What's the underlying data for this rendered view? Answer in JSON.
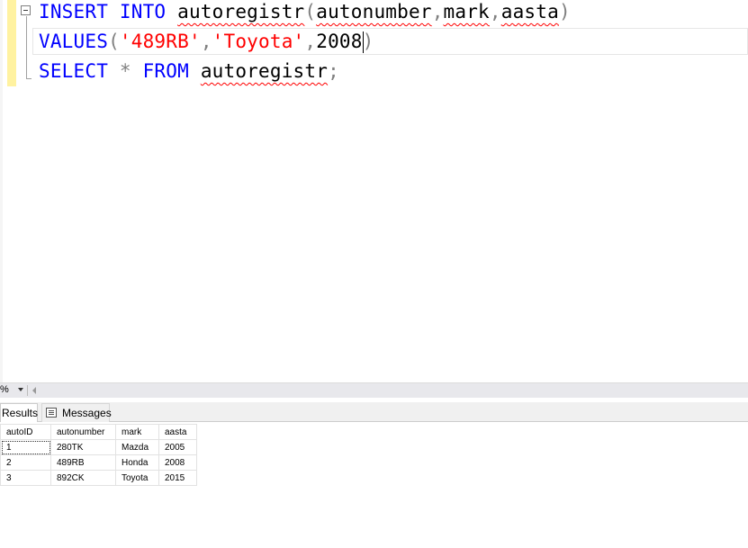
{
  "editor": {
    "line1": {
      "insert": "INSERT",
      "into": "INTO",
      "table": "autoregistr",
      "open_paren": "(",
      "col1": "autonumber",
      "comma1": ",",
      "col2": "mark",
      "comma2": ",",
      "col3": "aasta",
      "close_paren": ")"
    },
    "line2": {
      "values": "VALUES",
      "open_paren": "(",
      "val1": "'489RB'",
      "comma1": ",",
      "val2": "'Toyota'",
      "comma2": ",",
      "val3": "2008",
      "close_paren": ")"
    },
    "line3": {
      "select": "SELECT",
      "star": "*",
      "from": "FROM",
      "table": "autoregistr",
      "semicolon": ";"
    }
  },
  "zoom": {
    "value": "%"
  },
  "tabs": {
    "results": "Results",
    "messages": "Messages"
  },
  "grid": {
    "columns": [
      "autoID",
      "autonumber",
      "mark",
      "aasta"
    ],
    "rows": [
      [
        "1",
        "280TK",
        "Mazda",
        "2005"
      ],
      [
        "2",
        "489RB",
        "Honda",
        "2008"
      ],
      [
        "3",
        "892CK",
        "Toyota",
        "2015"
      ]
    ]
  },
  "colors": {
    "keyword": "#0000ff",
    "string": "#ff0000",
    "punctuation": "#808080",
    "squiggle": "#ff0000",
    "change_marker": "#fff2a0"
  }
}
